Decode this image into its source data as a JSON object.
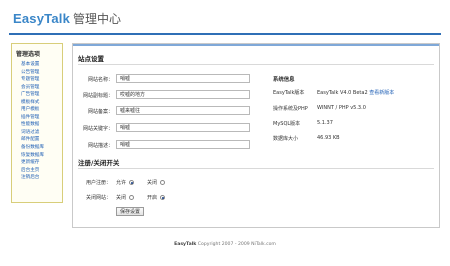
{
  "header": {
    "brand": "EasyTalk",
    "subtitle": "管理中心",
    "rule_color": "#2f6fb6",
    "brand_color": "#3a86c8"
  },
  "sidebar": {
    "title": "管理选项",
    "items": [
      {
        "label": "基本设置"
      },
      {
        "label": "公告管理"
      },
      {
        "label": "专题管理"
      },
      {
        "label": "会员管理"
      },
      {
        "label": "广告管理"
      },
      {
        "label": "模板样式"
      },
      {
        "label": "用户模板"
      },
      {
        "label": "插件管理"
      },
      {
        "label": "性能数据"
      },
      {
        "label": "词语过滤"
      },
      {
        "label": "邮件配置"
      },
      {
        "label": "备份数据库"
      },
      {
        "label": "恢复数据库"
      },
      {
        "label": "更新缓存"
      },
      {
        "label": "后台主页"
      },
      {
        "label": "注销后台"
      }
    ]
  },
  "site_settings": {
    "title": "站点设置",
    "fields": [
      {
        "label": "网站名称：",
        "value": "哨嘘"
      },
      {
        "label": "网站副标题：",
        "value": "哎嘘的地方"
      },
      {
        "label": "网站备案：",
        "value": "嘘来嘘往"
      },
      {
        "label": "网站关键字：",
        "value": "哨嘘"
      },
      {
        "label": "网站描述：",
        "value": "哨嘘"
      }
    ]
  },
  "system_info": {
    "title": "系统信息",
    "rows": [
      {
        "label": "EasyTalk版本",
        "value": "EasyTalk V4.0 Beta2",
        "link": "查看新版本"
      },
      {
        "label": "操作系统及PHP",
        "value": "WINNT / PHP v5.3.0"
      },
      {
        "label": "MySQL版本",
        "value": "5.1.37"
      },
      {
        "label": "数据库大小",
        "value": "46.93 KB"
      }
    ]
  },
  "switches": {
    "title": "注册/关闭开关",
    "rows": [
      {
        "label": "用户注册：",
        "options": [
          "允许",
          "关闭"
        ],
        "selected": 0
      },
      {
        "label": "关闭网站：",
        "options": [
          "关闭",
          "开启"
        ],
        "selected": 1
      }
    ]
  },
  "save_label": "保存设置",
  "footer": {
    "brand": "EasyTalk",
    "text": "Copyright 2007 - 2009 NiTalk.com"
  }
}
